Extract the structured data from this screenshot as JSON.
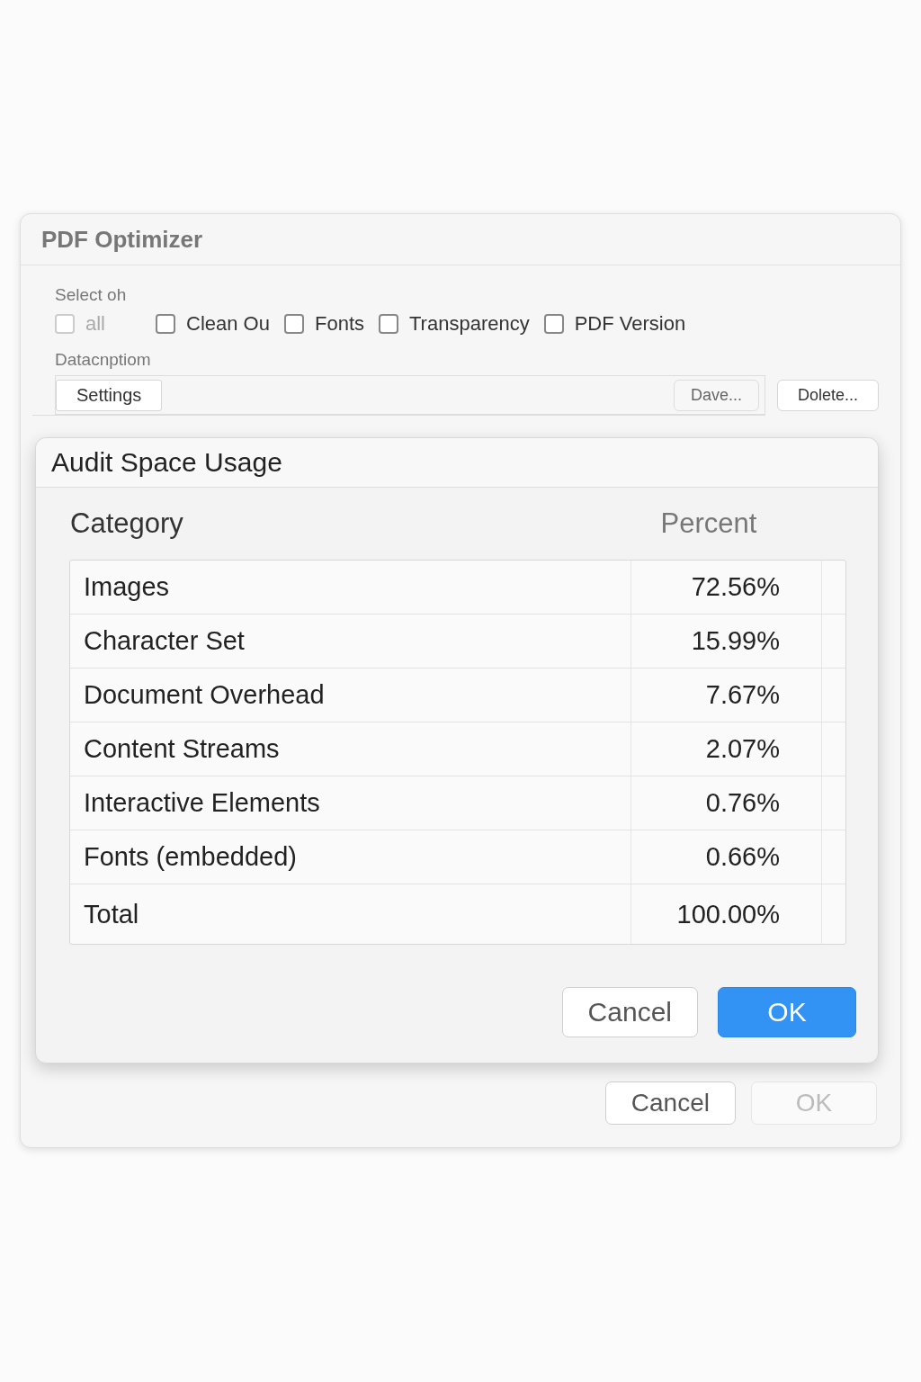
{
  "window": {
    "title": "PDF Optimizer"
  },
  "options": {
    "label": "Select oh",
    "checkboxes": [
      {
        "label": "all",
        "checked": false,
        "disabled": true
      },
      {
        "label": "Clean Ou",
        "checked": false,
        "disabled": false
      },
      {
        "label": "Fonts",
        "checked": false,
        "disabled": false
      },
      {
        "label": "Transparency",
        "checked": false,
        "disabled": false
      },
      {
        "label": "PDF Version",
        "checked": false,
        "disabled": false
      }
    ]
  },
  "description": {
    "label": "Datacnptiom",
    "settings": "Settings",
    "save_button": "Dave...",
    "delete_button": "Dolete..."
  },
  "buttons": [
    {
      "label": "Cancel",
      "disabled": false
    },
    {
      "label": "OK",
      "disabled": true
    }
  ],
  "modal": {
    "title": "Audit Space Usage",
    "columns": [
      "Category",
      "Percent"
    ],
    "rows": [
      {
        "category": "Images",
        "percent": "72.56%"
      },
      {
        "category": "Character Set",
        "percent": "15.99%"
      },
      {
        "category": "Document Overhead",
        "percent": "7.67%"
      },
      {
        "category": "Content Streams",
        "percent": "2.07%"
      },
      {
        "category": "Interactive Elements",
        "percent": "0.76%"
      },
      {
        "category": "Fonts (embedded)",
        "percent": "0.66%"
      },
      {
        "category": "Total",
        "percent": "100.00%"
      }
    ],
    "buttons": [
      {
        "label": "Cancel",
        "primary": false,
        "disabled": false
      },
      {
        "label": "OK",
        "primary": true,
        "disabled": false
      }
    ]
  }
}
